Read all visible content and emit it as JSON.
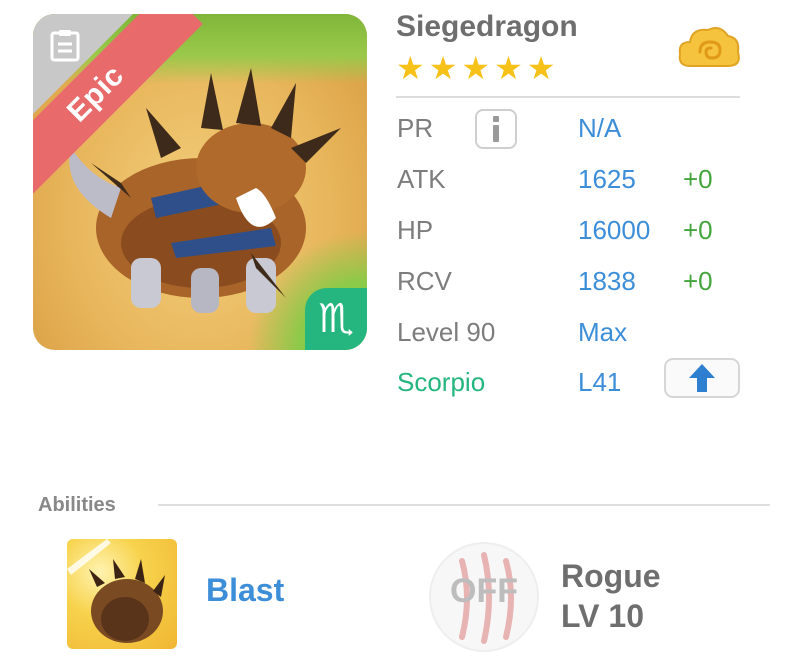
{
  "monster": {
    "name": "Siegedragon",
    "rarity_label": "Epic",
    "star_count": 5,
    "zodiac_glyph": "♏"
  },
  "stats": {
    "pr_label": "PR",
    "pr_value": "N/A",
    "atk_label": "ATK",
    "atk_value": "1625",
    "atk_bonus": "+0",
    "hp_label": "HP",
    "hp_value": "16000",
    "hp_bonus": "+0",
    "rcv_label": "RCV",
    "rcv_value": "1838",
    "rcv_bonus": "+0",
    "level_label": "Level 90",
    "level_value": "Max",
    "zodiac_label": "Scorpio",
    "zodiac_value": "L41"
  },
  "abilities": {
    "title": "Abilities",
    "ability_name": "Blast",
    "rogue_status": "OFF",
    "rogue_name": "Rogue",
    "rogue_level": "LV 10"
  },
  "icons": {
    "doc": "document-icon",
    "cloud": "cloud-currency-icon",
    "info": "info-icon",
    "upgrade": "up-arrow-icon",
    "ability": "claw-paw-icon",
    "rogue": "claw-scratch-icon"
  },
  "colors": {
    "accent_blue": "#3d8ed8",
    "bonus_green": "#43a53c",
    "zodiac_green": "#24b67e",
    "epic_red": "#e86a6a",
    "star_gold": "#f6c21a"
  }
}
